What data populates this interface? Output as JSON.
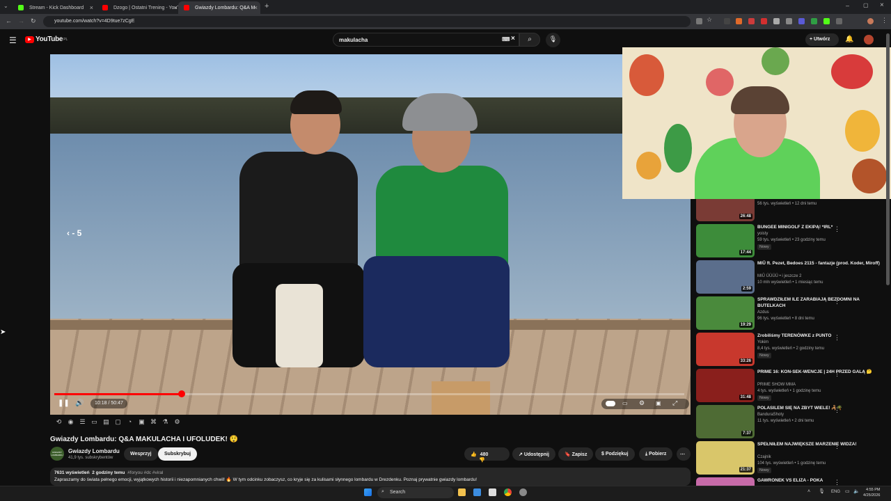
{
  "browser": {
    "tabs": [
      {
        "title": "Stream - Kick Dashboard",
        "color": "#53fc18"
      },
      {
        "title": "Dzogo | Ostatni Trening - YouT",
        "color": "#ff0000"
      },
      {
        "title": "Gwiazdy Lombardu: Q&A M",
        "color": "#ff0000"
      }
    ],
    "new_tab": "+",
    "url": "youtube.com/watch?v=4D9tue7zCgE"
  },
  "youtube": {
    "logo": "YouTube",
    "region": "PL",
    "search_value": "makulacha",
    "create_label": "Utwórz"
  },
  "player": {
    "seek_indicator": "‹  - 5",
    "time_current": "10:18",
    "time_total": "50:47",
    "time_display": "10:18 / 50:47",
    "progress_fraction": 0.2026
  },
  "video": {
    "title": "Gwiazdy Lombardu: Q&A MAKULACHA I UFOLUDEK! 😲",
    "channel": "Gwiazdy Lombardu",
    "channel_avatar_text": "GWIAZDY LOMBARDU",
    "subscribers": "41,9 tys. subskrybentów",
    "support_label": "Wesprzyj",
    "subscribe_label": "Subskrybuj",
    "likes": "480",
    "share_label": "Udostępnij",
    "save_label": "Zapisz",
    "thanks_label": "Podziękuj",
    "download_label": "Pobierz",
    "views": "7631 wyświetleń",
    "age": "2 godziny temu",
    "tags": "#foryou #dc #viral",
    "description": "Zapraszamy do świata pełnego emocji, wyjątkowych historii i niezapomnianych chwil! 🔥 W tym odcinku zobaczysz, co kryje się za kulisami słynnego lombardu w Drezdenku. Poznaj prywatnie gwiazdy lombardu!"
  },
  "recommendations": [
    {
      "title": "",
      "channel": "",
      "meta": "56 tys. wyświetleń • 12 dni temu",
      "duration": "26:48",
      "badge": "",
      "thumb": "#7a3b35"
    },
    {
      "title": "BUNGEE MINIGOLF Z EKIPĄ! *IRL*",
      "channel": "yoisty",
      "meta": "59 tys. wyświetleń • 23 godziny temu",
      "duration": "17:44",
      "badge": "Nowy",
      "thumb": "#3d8c3a"
    },
    {
      "title": "MIŪ ft. Pezet, Bedoes 2115 - fantazje (prod. Koder, Miroff)",
      "channel": "MIŪ ÜÜÜÜ • i jeszcze 2",
      "meta": "10 mln wyświetleń • 1 miesiąc temu",
      "duration": "2:59",
      "badge": "",
      "thumb": "#5b6e8c"
    },
    {
      "title": "SPRAWDZIŁEM ILE ZARABIAJĄ BEZDOMNI NA BUTELKACH",
      "channel": "Azdus",
      "meta": "96 tys. wyświetleń • 8 dni temu",
      "duration": "19:29",
      "badge": "",
      "thumb": "#4a8a3c"
    },
    {
      "title": "Zrobiliśmy TERENÓWKE z PUNTO",
      "channel": "Yokim",
      "meta": "8,4 tys. wyświetleń • 2 godziny temu",
      "duration": "33:26",
      "badge": "Nowy",
      "thumb": "#c8382d"
    },
    {
      "title": "PRIME 16: KON-SEK-WENCJE | 24H PRZED GALĄ 🤔",
      "channel": "PRIME SHOW MMA",
      "meta": "4 tys. wyświetleń • 1 godzinę temu",
      "duration": "31:48",
      "badge": "Nowy",
      "thumb": "#8a1f1c"
    },
    {
      "title": "POLASILEM SIĘ NA ZBYT WIELE! 🦂🌴",
      "channel": "BanduraShoty",
      "meta": "11 tys. wyświetleń • 2 dni temu",
      "duration": "7:37",
      "badge": "",
      "thumb": "#4e6b34"
    },
    {
      "title": "SPEŁNIŁEM NAJWIĘKSZE MARZENIE WIDZA!",
      "channel": "Czajnik",
      "meta": "104 tys. wyświetleń • 1 godzinę temu",
      "duration": "21:37",
      "badge": "Nowy",
      "thumb": "#d9c66a"
    },
    {
      "title": "GAWRONEK VS ELIZA - POKA",
      "channel": "",
      "meta": "",
      "duration": "",
      "badge": "",
      "thumb": "#c76aa8"
    }
  ],
  "taskbar": {
    "search_label": "Search",
    "lang": "ENG",
    "time": "4:55 PM",
    "date": "4/25/2026"
  }
}
